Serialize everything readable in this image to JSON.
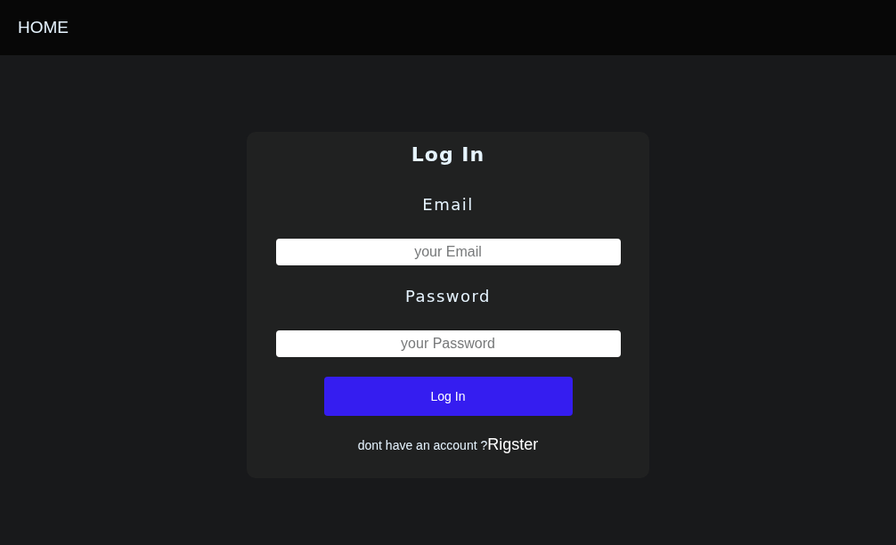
{
  "nav": {
    "home": "HOME"
  },
  "login": {
    "title": "Log In",
    "fields": [
      {
        "label": "Email",
        "placeholder": "your Email"
      },
      {
        "label": "Password",
        "placeholder": "your Password"
      }
    ],
    "button": "Log In",
    "footer": {
      "text": "dont have an account ?",
      "link": "Rigster"
    }
  }
}
